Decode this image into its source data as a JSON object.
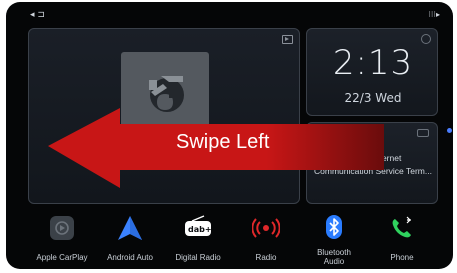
{
  "status": {
    "left_glyph": "◂ ⊐",
    "right_glyph": "⁝⁝⁝▸"
  },
  "clock": {
    "time": "2:13",
    "date": "22/3  Wed"
  },
  "terms_card": {
    "line1": "he Internet",
    "line2": "Communication Service Term..."
  },
  "overlay": {
    "label": "Swipe Left"
  },
  "dock": [
    {
      "label": "Apple CarPlay"
    },
    {
      "label": "Android Auto"
    },
    {
      "label": "Digital Radio",
      "glyph": "dab+"
    },
    {
      "label": "Radio"
    },
    {
      "label_line1": "Bluetooth",
      "label_line2": "Audio"
    },
    {
      "label": "Phone"
    }
  ],
  "colors": {
    "arrow": "#c81616",
    "android_auto": "#3b82ff",
    "radio": "#e0282a",
    "bluetooth": "#2a7cff",
    "phone": "#2fd25e",
    "card_border": "#3a4049"
  }
}
